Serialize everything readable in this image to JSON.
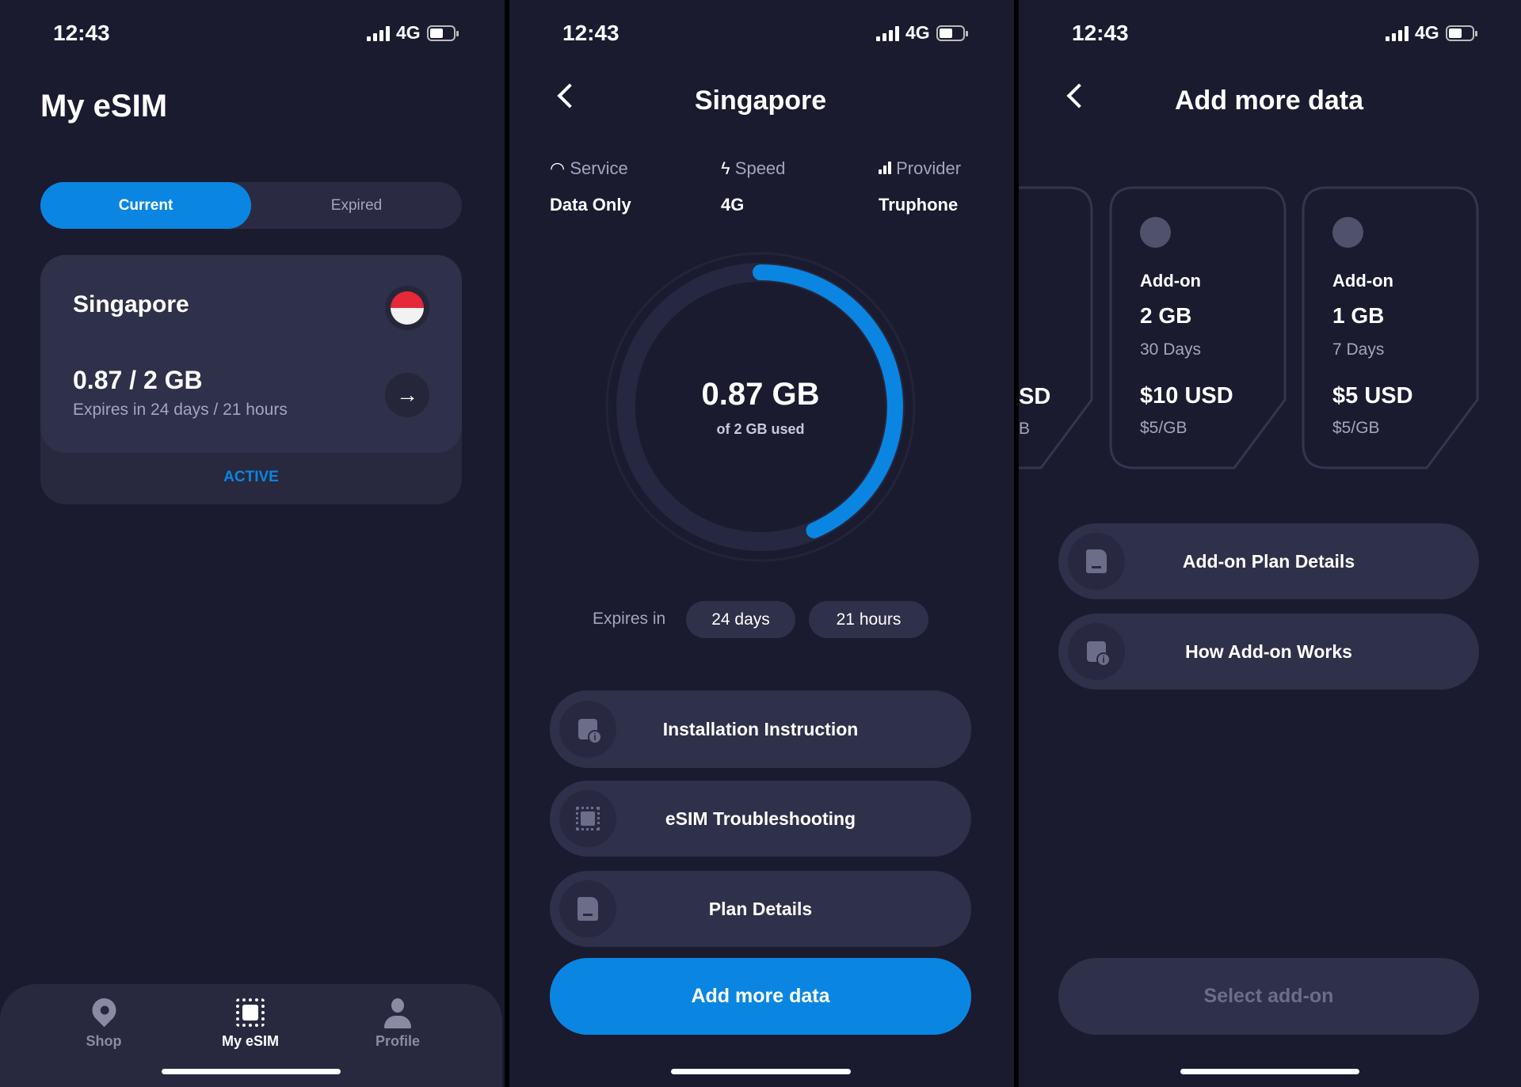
{
  "status_bar": {
    "time": "12:43",
    "network": "4G"
  },
  "screen1": {
    "title": "My eSIM",
    "tabs": [
      {
        "label": "Current",
        "active": true
      },
      {
        "label": "Expired",
        "active": false
      }
    ],
    "card": {
      "country": "Singapore",
      "usage": "0.87 / 2 GB",
      "expiry": "Expires in 24 days / 21 hours",
      "status": "ACTIVE"
    },
    "nav": [
      {
        "label": "Shop",
        "icon": "map-pin-icon"
      },
      {
        "label": "My eSIM",
        "icon": "chip-icon",
        "active": true
      },
      {
        "label": "Profile",
        "icon": "person-icon"
      }
    ]
  },
  "screen2": {
    "title": "Singapore",
    "info": [
      {
        "label": "Service",
        "value": "Data Only",
        "icon": "wifi-icon"
      },
      {
        "label": "Speed",
        "value": "4G",
        "icon": "bolt-icon"
      },
      {
        "label": "Provider",
        "value": "Truphone",
        "icon": "signal-icon"
      }
    ],
    "usage": {
      "used": 0.87,
      "total": 2,
      "main": "0.87 GB",
      "sub": "of 2 GB used"
    },
    "expires": {
      "label": "Expires in",
      "days": "24 days",
      "hours": "21 hours"
    },
    "buttons": [
      {
        "label": "Installation Instruction",
        "icon": "document-info-icon"
      },
      {
        "label": "eSIM Troubleshooting",
        "icon": "chip-icon"
      },
      {
        "label": "Plan Details",
        "icon": "document-icon"
      }
    ],
    "cta": "Add more data"
  },
  "screen3": {
    "title": "Add more data",
    "partial_card": {
      "price": "SD",
      "per_gb": "B"
    },
    "cards": [
      {
        "type": "Add-on",
        "size": "2 GB",
        "duration": "30 Days",
        "price": "$10 USD",
        "per_gb": "$5/GB"
      },
      {
        "type": "Add-on",
        "size": "1 GB",
        "duration": "7 Days",
        "price": "$5 USD",
        "per_gb": "$5/GB"
      }
    ],
    "buttons": [
      {
        "label": "Add-on Plan Details",
        "icon": "document-icon"
      },
      {
        "label": "How Add-on Works",
        "icon": "document-info-icon"
      }
    ],
    "cta": "Select add-on"
  },
  "colors": {
    "accent": "#0a86e2",
    "background": "#1a1b2f",
    "surface": "#2f3049"
  }
}
